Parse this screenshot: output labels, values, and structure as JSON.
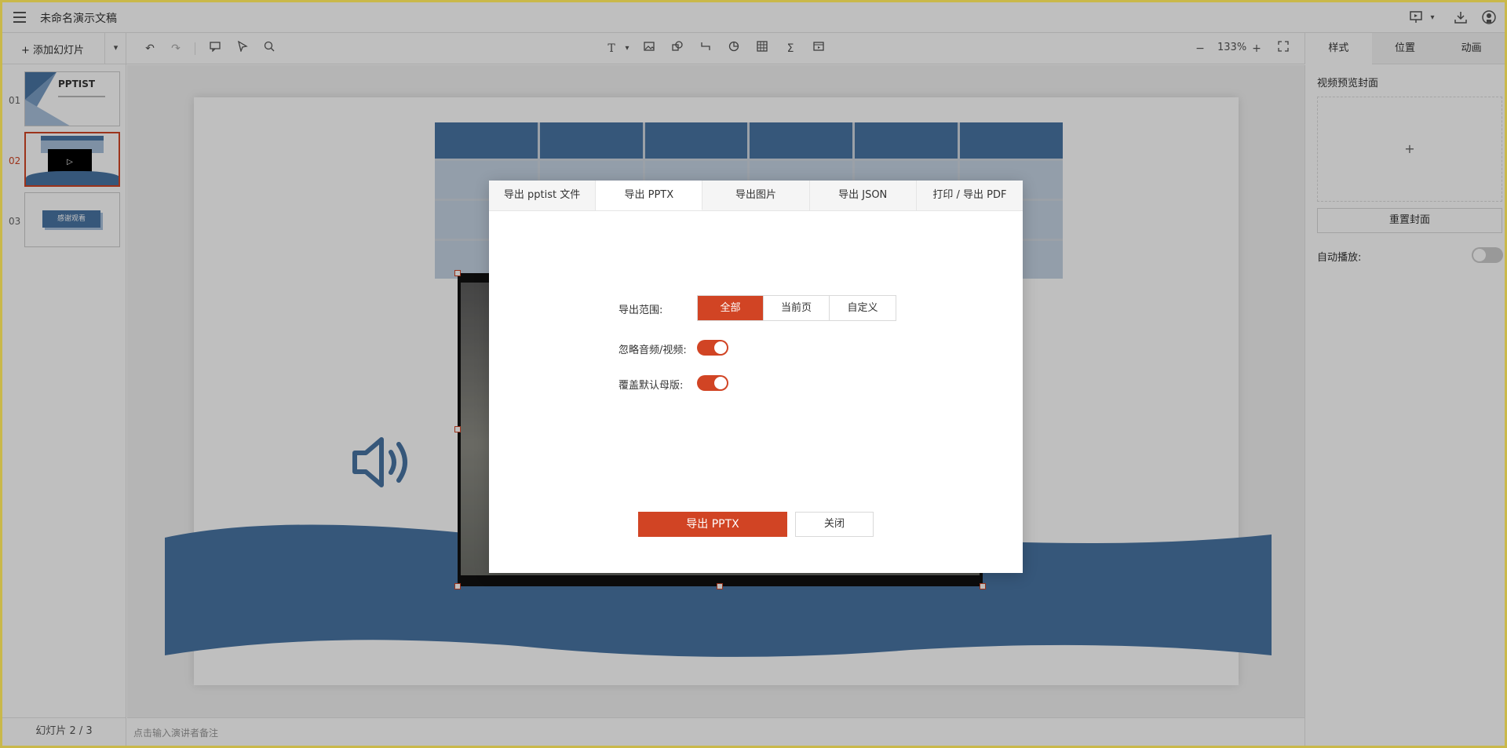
{
  "app": {
    "title": "未命名演示文稿"
  },
  "toolbar": {
    "add_slide_label": "+ 添加幻灯片",
    "zoom": "133%",
    "icons": [
      "undo-icon",
      "redo-icon",
      "comment-icon",
      "pointer-icon",
      "search-icon",
      "text-icon",
      "image-icon",
      "shape-icon",
      "line-icon",
      "chart-icon",
      "table-icon",
      "formula-icon",
      "media-icon",
      "zoom-out-icon",
      "zoom-in-icon",
      "fullscreen-icon"
    ]
  },
  "panel": {
    "tabs": [
      "样式",
      "位置",
      "动画"
    ],
    "active_tab": "样式",
    "cover_title": "视频预览封面",
    "cover_placeholder": "+",
    "reset_cover_label": "重置封面",
    "autoplay_label": "自动播放:"
  },
  "thumbnails": [
    {
      "num": "01",
      "title": "PPTIST"
    },
    {
      "num": "02",
      "active": true
    },
    {
      "num": "03",
      "title": "感谢观看"
    }
  ],
  "status": {
    "slide_counter": "幻灯片 2 / 3",
    "notes_placeholder": "点击输入演讲者备注"
  },
  "dialog": {
    "tabs": [
      "导出 pptist 文件",
      "导出 PPTX",
      "导出图片",
      "导出 JSON",
      "打印 / 导出 PDF"
    ],
    "active_tab": "导出 PPTX",
    "range_label": "导出范围:",
    "range_options": [
      "全部",
      "当前页",
      "自定义"
    ],
    "range_selected": "全部",
    "ignore_media_label": "忽略音频/视频:",
    "ignore_media_on": true,
    "override_master_label": "覆盖默认母版:",
    "override_master_on": true,
    "export_button": "导出 PPTX",
    "close_button": "关闭"
  },
  "colors": {
    "accent": "#d14424",
    "slide_blue": "#4874a3"
  }
}
